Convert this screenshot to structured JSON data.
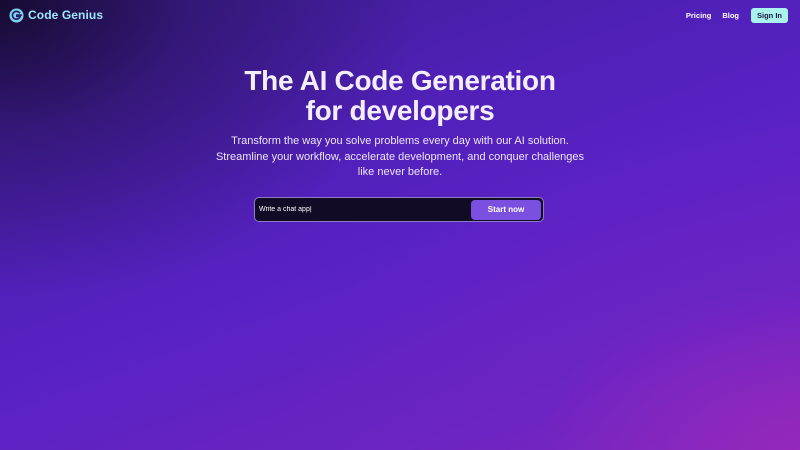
{
  "brand": {
    "name": "Code Genius",
    "logo_icon": "g-logo-icon",
    "color": "#9fe7ff"
  },
  "nav": {
    "items": [
      {
        "label": "Pricing"
      },
      {
        "label": "Blog"
      }
    ],
    "signin_label": "Sign In",
    "signin_color": "#a9f3ec"
  },
  "hero": {
    "title_line1": "The AI Code Generation",
    "title_line2": "for developers",
    "subtitle": "Transform the way you solve problems every day with our AI solution. Streamline your workflow, accelerate development, and conquer challenges like never before."
  },
  "prompt": {
    "value": "Write a chat app|",
    "button_label": "Start now",
    "button_color": "#7b4fdf"
  },
  "colors": {
    "background_start": "#3a1d8c",
    "background_mid": "#5a22c4",
    "background_end": "#8a2ab0"
  }
}
